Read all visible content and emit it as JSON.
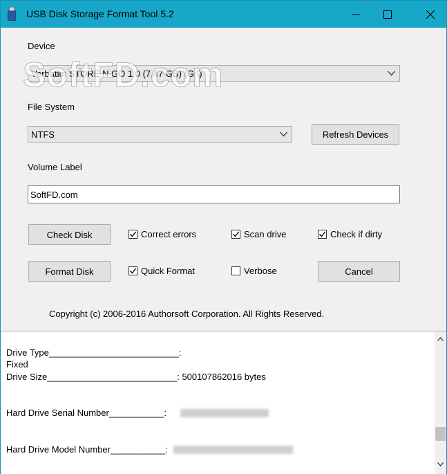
{
  "window": {
    "title": "USB Disk Storage Format Tool 5.2"
  },
  "device": {
    "label": "Device",
    "value": "Verbatim  STORE N GO  1.0 (7.47 GB) (G:\\)"
  },
  "filesystem": {
    "label": "File System",
    "value": "NTFS",
    "refresh_label": "Refresh Devices"
  },
  "volume": {
    "label": "Volume Label",
    "value": "SoftFD.com"
  },
  "actions": {
    "check_disk": "Check Disk",
    "format_disk": "Format Disk",
    "cancel": "Cancel"
  },
  "options": {
    "correct_errors": {
      "label": "Correct errors",
      "checked": true
    },
    "scan_drive": {
      "label": "Scan drive",
      "checked": true
    },
    "check_if_dirty": {
      "label": "Check if dirty",
      "checked": true
    },
    "quick_format": {
      "label": "Quick Format",
      "checked": true
    },
    "verbose": {
      "label": "Verbose",
      "checked": false
    }
  },
  "watermark": "SoftFD.com",
  "copyright": "Copyright (c) 2006-2016 Authorsoft Corporation. All Rights Reserved.",
  "log": {
    "drive_type": "Drive Type__________________________:",
    "drive_type_value": "Fixed",
    "drive_size": "Drive Size__________________________: 500107862016 bytes",
    "serial": "Hard Drive Serial Number___________:",
    "model": "Hard Drive Model Number___________:"
  },
  "colors": {
    "titlebar": "#17a8c9",
    "window_bg": "#f0f0f0",
    "button_bg": "#e1e1e1"
  }
}
